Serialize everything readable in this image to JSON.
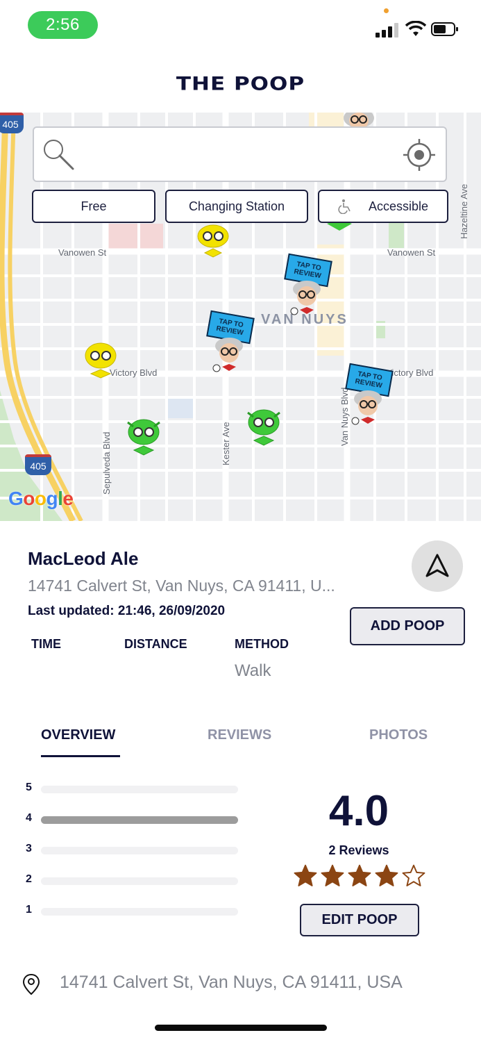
{
  "status_bar": {
    "time": "2:56"
  },
  "app": {
    "title": "THE POOP"
  },
  "search": {
    "value": "",
    "placeholder": ""
  },
  "filters": [
    {
      "label": "Free"
    },
    {
      "label": "Changing Station"
    },
    {
      "label": "Accessible",
      "icon": "wheelchair-icon"
    }
  ],
  "map": {
    "streets": [
      "Vanowen St",
      "Vanowen St",
      "Victory Blvd",
      "Victory Blvd",
      "Sepulveda Blvd",
      "Kester Ave",
      "Van Nuys Blvd",
      "Hazeltine Ave"
    ],
    "district": "VAN NUYS",
    "highway_shields": [
      "405",
      "405"
    ],
    "attribution": "Google",
    "pin_sign_text": "TAP TO REVIEW"
  },
  "place": {
    "name": "MacLeod Ale",
    "address": "14741 Calvert St, Van Nuys, CA 91411, U...",
    "last_updated": "Last updated: 21:46, 26/09/2020"
  },
  "actions": {
    "add_poop": "ADD POOP",
    "edit_poop": "EDIT POOP"
  },
  "stats": {
    "headers": [
      "TIME",
      "DISTANCE",
      "METHOD"
    ],
    "method_value": "Walk"
  },
  "tabs": [
    "OVERVIEW",
    "REVIEWS",
    "PHOTOS"
  ],
  "ratings": {
    "average": "4.0",
    "review_count": "2 Reviews",
    "stars_filled": 4,
    "stars_total": 5,
    "distribution": [
      {
        "label": "5",
        "fraction": 0
      },
      {
        "label": "4",
        "fraction": 1.0
      },
      {
        "label": "3",
        "fraction": 0
      },
      {
        "label": "2",
        "fraction": 0
      },
      {
        "label": "1",
        "fraction": 0
      }
    ]
  },
  "footer": {
    "address": "14741 Calvert St, Van Nuys, CA 91411, USA"
  },
  "colors": {
    "navy": "#0f1238",
    "star": "#8b4513",
    "status_green": "#3ccb5a",
    "sign_blue": "#28a9e8",
    "pin_green": "#3fc93a",
    "pin_yellow": "#f2e200"
  }
}
